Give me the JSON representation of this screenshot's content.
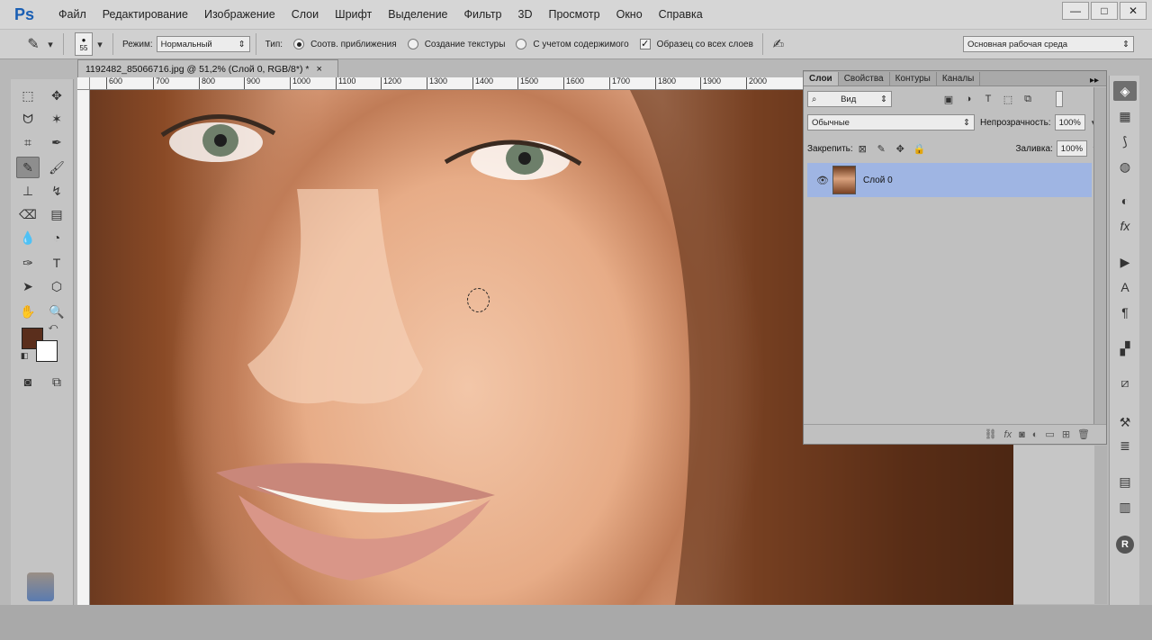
{
  "app": {
    "logo": "Ps"
  },
  "menu": [
    "Файл",
    "Редактирование",
    "Изображение",
    "Слои",
    "Шрифт",
    "Выделение",
    "Фильтр",
    "3D",
    "Просмотр",
    "Окно",
    "Справка"
  ],
  "window_controls": {
    "minimize": "—",
    "restore": "□",
    "close": "✕"
  },
  "options_bar": {
    "brush_size": "55",
    "mode_label": "Режим:",
    "mode_value": "Нормальный",
    "type_label": "Тип:",
    "radio_proximity": "Соотв. приближения",
    "radio_texture": "Создание текстуры",
    "radio_content": "С учетом содержимого",
    "sample_all_layers": "Образец со всех слоев",
    "workspace": "Основная рабочая среда"
  },
  "document": {
    "tab_title": "1192482_85066716.jpg @ 51,2% (Слой 0, RGB/8*) *",
    "close": "×",
    "ruler_ticks": [
      "600",
      "700",
      "800",
      "900",
      "1000",
      "1100",
      "1200",
      "1300",
      "1400",
      "1500",
      "1600",
      "1700",
      "1800",
      "1900",
      "2000"
    ]
  },
  "layers_panel": {
    "tabs": [
      "Слои",
      "Свойства",
      "Контуры",
      "Каналы"
    ],
    "menu_icon": "▸▸",
    "filter_label": "Вид",
    "blend_mode": "Обычные",
    "opacity_label": "Непрозрачность:",
    "opacity_value": "100%",
    "lock_label": "Закрепить:",
    "fill_label": "Заливка:",
    "fill_value": "100%",
    "layers": [
      {
        "name": "Слой 0",
        "visible": true,
        "selected": true
      }
    ]
  },
  "colors": {
    "foreground": "#5a2e1c",
    "background": "#ffffff",
    "selection": "#9fb5e3"
  }
}
